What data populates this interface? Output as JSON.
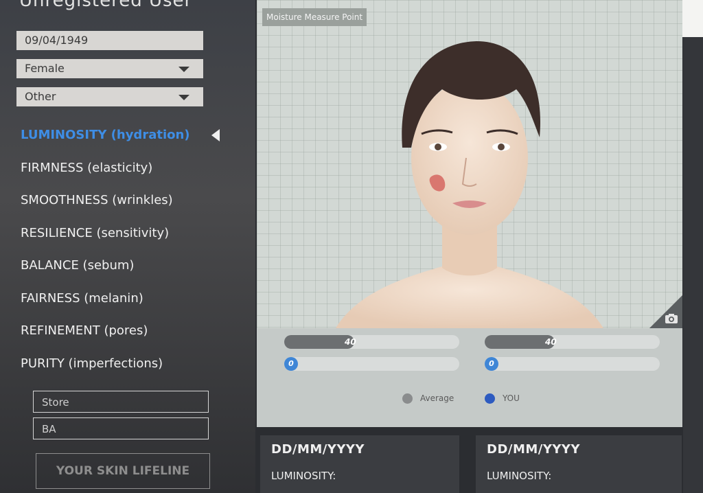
{
  "user": {
    "header": "Unregistered User",
    "birth_date": "09/04/1949",
    "gender": "Female",
    "ethnicity": "Other"
  },
  "menu": {
    "items": [
      {
        "label": "LUMINOSITY (hydration)",
        "active": true
      },
      {
        "label": "FIRMNESS (elasticity)",
        "active": false
      },
      {
        "label": "SMOOTHNESS (wrinkles)",
        "active": false
      },
      {
        "label": "RESILIENCE (sensitivity)",
        "active": false
      },
      {
        "label": "BALANCE (sebum)",
        "active": false
      },
      {
        "label": "FAIRNESS (melanin)",
        "active": false
      },
      {
        "label": "REFINEMENT (pores)",
        "active": false
      },
      {
        "label": "PURITY (imperfections)",
        "active": false
      }
    ]
  },
  "store_field": {
    "placeholder": "Store"
  },
  "ba_field": {
    "placeholder": "BA"
  },
  "lifeline_button": {
    "label": "YOUR SKIN LIFELINE"
  },
  "face_panel": {
    "measure_label": "Moisture Measure Point",
    "left_bars": {
      "average_value": "40",
      "you_value": "0",
      "average_fraction": 0.4,
      "you_fraction": 0
    },
    "right_bars": {
      "average_value": "40",
      "you_value": "0",
      "average_fraction": 0.4,
      "you_fraction": 0
    },
    "legend": {
      "average_label": "Average",
      "you_label": "YOU",
      "average_color": "#8a8c8d",
      "you_color": "#2e5bc0"
    }
  },
  "cards": [
    {
      "date": "DD/MM/YYYY",
      "metric": "LUMINOSITY:"
    },
    {
      "date": "DD/MM/YYYY",
      "metric": "LUMINOSITY:"
    }
  ],
  "colors": {
    "accent": "#3e8ee6",
    "panel": "#c6cdc9",
    "dark": "#2b2d31"
  },
  "icons": [
    "chevron-down-icon",
    "active-pointer-icon",
    "camera-icon"
  ]
}
